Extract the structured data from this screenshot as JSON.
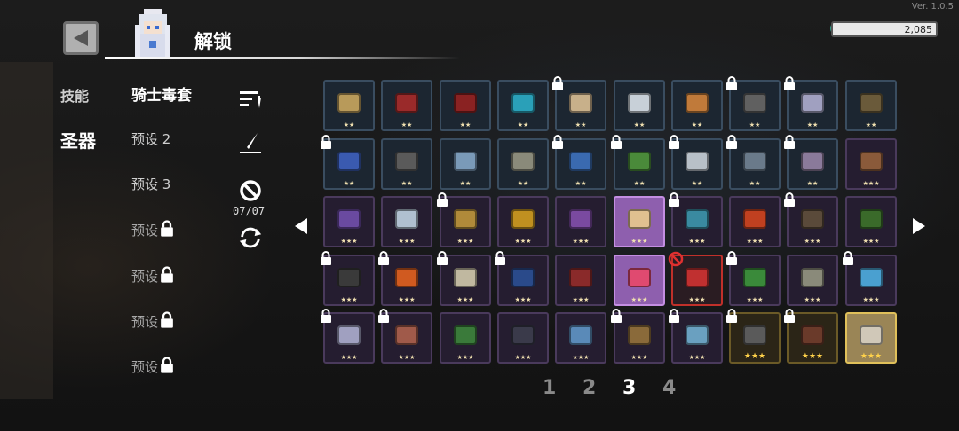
{
  "version": "Ver. 1.0.5",
  "header": {
    "title": "解锁",
    "currency_value": "2,085"
  },
  "categories": [
    {
      "label": "技能",
      "active": false
    },
    {
      "label": "圣器",
      "active": true
    }
  ],
  "presets": [
    {
      "label": "骑士毒套",
      "locked": false,
      "active": true
    },
    {
      "label": "预设 2",
      "locked": false,
      "active": false
    },
    {
      "label": "预设 3",
      "locked": false,
      "active": false
    },
    {
      "label": "预设",
      "locked": true,
      "active": false
    },
    {
      "label": "预设",
      "locked": true,
      "active": false
    },
    {
      "label": "预设",
      "locked": true,
      "active": false
    },
    {
      "label": "预设",
      "locked": true,
      "active": false
    }
  ],
  "tools": {
    "counter": "07/07"
  },
  "pagination": {
    "pages": [
      "1",
      "2",
      "3",
      "4"
    ],
    "current": "3"
  },
  "relic_grid": [
    [
      {
        "tier": "t1",
        "stars": "★★",
        "locked": false,
        "color": "#b89a5a"
      },
      {
        "tier": "t1",
        "stars": "★★",
        "locked": false,
        "color": "#9a2a2a"
      },
      {
        "tier": "t1",
        "stars": "★★",
        "locked": false,
        "color": "#8a2222"
      },
      {
        "tier": "t1",
        "stars": "★★",
        "locked": false,
        "color": "#2aa0b8"
      },
      {
        "tier": "t1",
        "stars": "★★",
        "locked": true,
        "color": "#c8b08a"
      },
      {
        "tier": "t1",
        "stars": "★★",
        "locked": false,
        "color": "#c8d0d8"
      },
      {
        "tier": "t1",
        "stars": "★★",
        "locked": false,
        "color": "#c07a3a"
      },
      {
        "tier": "t1",
        "stars": "★★",
        "locked": true,
        "color": "#606060"
      },
      {
        "tier": "t1",
        "stars": "★★",
        "locked": true,
        "color": "#a0a0c0"
      },
      {
        "tier": "t1",
        "stars": "★★",
        "locked": false,
        "color": "#6a5a3a"
      }
    ],
    [
      {
        "tier": "t1",
        "stars": "★★",
        "locked": true,
        "color": "#3a5ab0"
      },
      {
        "tier": "t1",
        "stars": "★★",
        "locked": false,
        "color": "#5a5a5a"
      },
      {
        "tier": "t1",
        "stars": "★★",
        "locked": false,
        "color": "#7a9ab8"
      },
      {
        "tier": "t1",
        "stars": "★★",
        "locked": false,
        "color": "#8a8a7a"
      },
      {
        "tier": "t1",
        "stars": "★★",
        "locked": true,
        "color": "#3a6ab0"
      },
      {
        "tier": "t1",
        "stars": "★★",
        "locked": true,
        "color": "#4a8a3a"
      },
      {
        "tier": "t1",
        "stars": "★★",
        "locked": true,
        "color": "#b8c0c8"
      },
      {
        "tier": "t1",
        "stars": "★★",
        "locked": true,
        "color": "#6a7a8a"
      },
      {
        "tier": "t1",
        "stars": "★★",
        "locked": true,
        "color": "#8a7a9a"
      },
      {
        "tier": "t2",
        "stars": "★★★",
        "locked": false,
        "color": "#8a5a3a"
      }
    ],
    [
      {
        "tier": "t2",
        "stars": "★★★",
        "locked": false,
        "color": "#6a4aa0"
      },
      {
        "tier": "t2",
        "stars": "★★★",
        "locked": false,
        "color": "#b0c0d0"
      },
      {
        "tier": "t2",
        "stars": "★★★",
        "locked": true,
        "color": "#b08a3a"
      },
      {
        "tier": "t2",
        "stars": "★★★",
        "locked": false,
        "color": "#c09020"
      },
      {
        "tier": "t2",
        "stars": "★★★",
        "locked": false,
        "color": "#7a4aa0"
      },
      {
        "tier": "sel",
        "stars": "★★★",
        "locked": false,
        "color": "#e0c090"
      },
      {
        "tier": "t2",
        "stars": "★★★",
        "locked": true,
        "color": "#3a8aa0"
      },
      {
        "tier": "t2",
        "stars": "★★★",
        "locked": false,
        "color": "#c04020"
      },
      {
        "tier": "t2",
        "stars": "★★★",
        "locked": true,
        "color": "#5a4a3a"
      },
      {
        "tier": "t2",
        "stars": "★★★",
        "locked": false,
        "color": "#3a6a2a"
      }
    ],
    [
      {
        "tier": "t2",
        "stars": "★★★",
        "locked": true,
        "color": "#3a3a3a"
      },
      {
        "tier": "t2",
        "stars": "★★★",
        "locked": true,
        "color": "#d05a20"
      },
      {
        "tier": "t2",
        "stars": "★★★",
        "locked": true,
        "color": "#c0b8a0"
      },
      {
        "tier": "t2",
        "stars": "★★★",
        "locked": true,
        "color": "#2a4a8a"
      },
      {
        "tier": "t2",
        "stars": "★★★",
        "locked": false,
        "color": "#8a2a2a"
      },
      {
        "tier": "sel",
        "stars": "★★★",
        "locked": false,
        "color": "#e04a70"
      },
      {
        "tier": "red",
        "stars": "★★★",
        "locked": false,
        "banned": true,
        "color": "#c03030"
      },
      {
        "tier": "t2",
        "stars": "★★★",
        "locked": true,
        "color": "#3a8a3a"
      },
      {
        "tier": "t2",
        "stars": "★★★",
        "locked": false,
        "color": "#8a8a7a"
      },
      {
        "tier": "t2",
        "stars": "★★★",
        "locked": true,
        "color": "#4aa0d0"
      }
    ],
    [
      {
        "tier": "t2",
        "stars": "★★★",
        "locked": true,
        "color": "#a0a0c0"
      },
      {
        "tier": "t2",
        "stars": "★★★",
        "locked": true,
        "color": "#a05a4a"
      },
      {
        "tier": "t2",
        "stars": "★★★",
        "locked": false,
        "color": "#3a7a3a"
      },
      {
        "tier": "t2",
        "stars": "★★★",
        "locked": false,
        "color": "#3a3a4a"
      },
      {
        "tier": "t2",
        "stars": "★★★",
        "locked": false,
        "color": "#5a8ab8"
      },
      {
        "tier": "t2",
        "stars": "★★★",
        "locked": true,
        "color": "#8a6a3a"
      },
      {
        "tier": "t2",
        "stars": "★★★",
        "locked": true,
        "color": "#6aa0c0"
      },
      {
        "tier": "t3",
        "stars": "★★★",
        "locked": true,
        "color": "#5a5a5a"
      },
      {
        "tier": "t3",
        "stars": "★★★",
        "locked": true,
        "color": "#6a3a2a"
      },
      {
        "tier": "gold-sel",
        "stars": "★★★",
        "locked": false,
        "color": "#d0c8b8"
      }
    ]
  ]
}
